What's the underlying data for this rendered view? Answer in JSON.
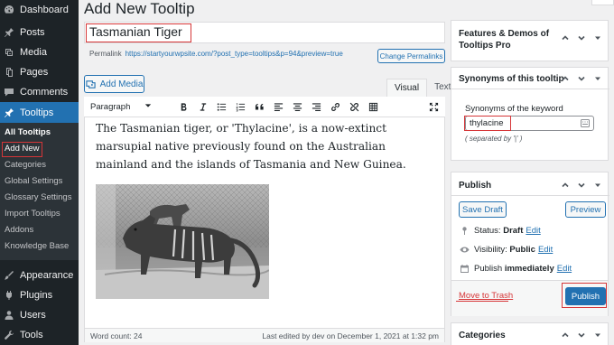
{
  "sidebar": {
    "items": [
      {
        "label": "Dashboard",
        "icon": "dashboard-icon"
      },
      {
        "label": "Posts",
        "icon": "pin-icon"
      },
      {
        "label": "Media",
        "icon": "media-icon"
      },
      {
        "label": "Pages",
        "icon": "pages-icon"
      },
      {
        "label": "Comments",
        "icon": "comments-icon"
      },
      {
        "label": "Tooltips",
        "icon": "pin-icon"
      },
      {
        "label": "Appearance",
        "icon": "brush-icon"
      },
      {
        "label": "Plugins",
        "icon": "plugin-icon"
      },
      {
        "label": "Users",
        "icon": "users-icon"
      },
      {
        "label": "Tools",
        "icon": "tools-icon"
      }
    ],
    "submenu": [
      "All Tooltips",
      "Add New",
      "Categories",
      "Global Settings",
      "Glossary Settings",
      "Import Tooltips",
      "Addons",
      "Knowledge Base"
    ]
  },
  "page": {
    "title": "Add New Tooltip",
    "post_title": "Tasmanian Tiger",
    "permalink_label": "Permalink",
    "permalink_url": "https://startyourwpsite.com/?post_type=tooltips&p=94&preview=true",
    "change_permalinks": "Change Permalinks"
  },
  "editor": {
    "add_media": "Add Media",
    "tab_visual": "Visual",
    "tab_text": "Text",
    "format": "Paragraph",
    "content": "The Tasmanian tiger, or 'Thylacine', is a now-extinct marsupial native previously found on the Australian mainland and the islands of Tasmania and New Guinea.",
    "word_count": "Word count: 24",
    "last_edited": "Last edited by dev on December 1, 2021 at 1:32 pm"
  },
  "panels": {
    "features_title": "Features & Demos of Tooltips Pro",
    "synonyms_title": "Synonyms of this tooltip",
    "synonyms_label": "Synonyms of the keyword",
    "synonyms_value": "thylacine",
    "synonyms_hint": "( separated by '|' )",
    "publish_title": "Publish",
    "save_draft": "Save Draft",
    "preview": "Preview",
    "status_label": "Status:",
    "status_value": "Draft",
    "visibility_label": "Visibility:",
    "visibility_value": "Public",
    "publish_label": "Publish",
    "publish_value": "immediately",
    "edit": "Edit",
    "trash": "Move to Trash",
    "publish_button": "Publish",
    "categories_title": "Categories"
  },
  "colors": {
    "sidebar_bg": "#1d2327",
    "accent": "#2271b1",
    "highlight_red": "#d63638"
  }
}
